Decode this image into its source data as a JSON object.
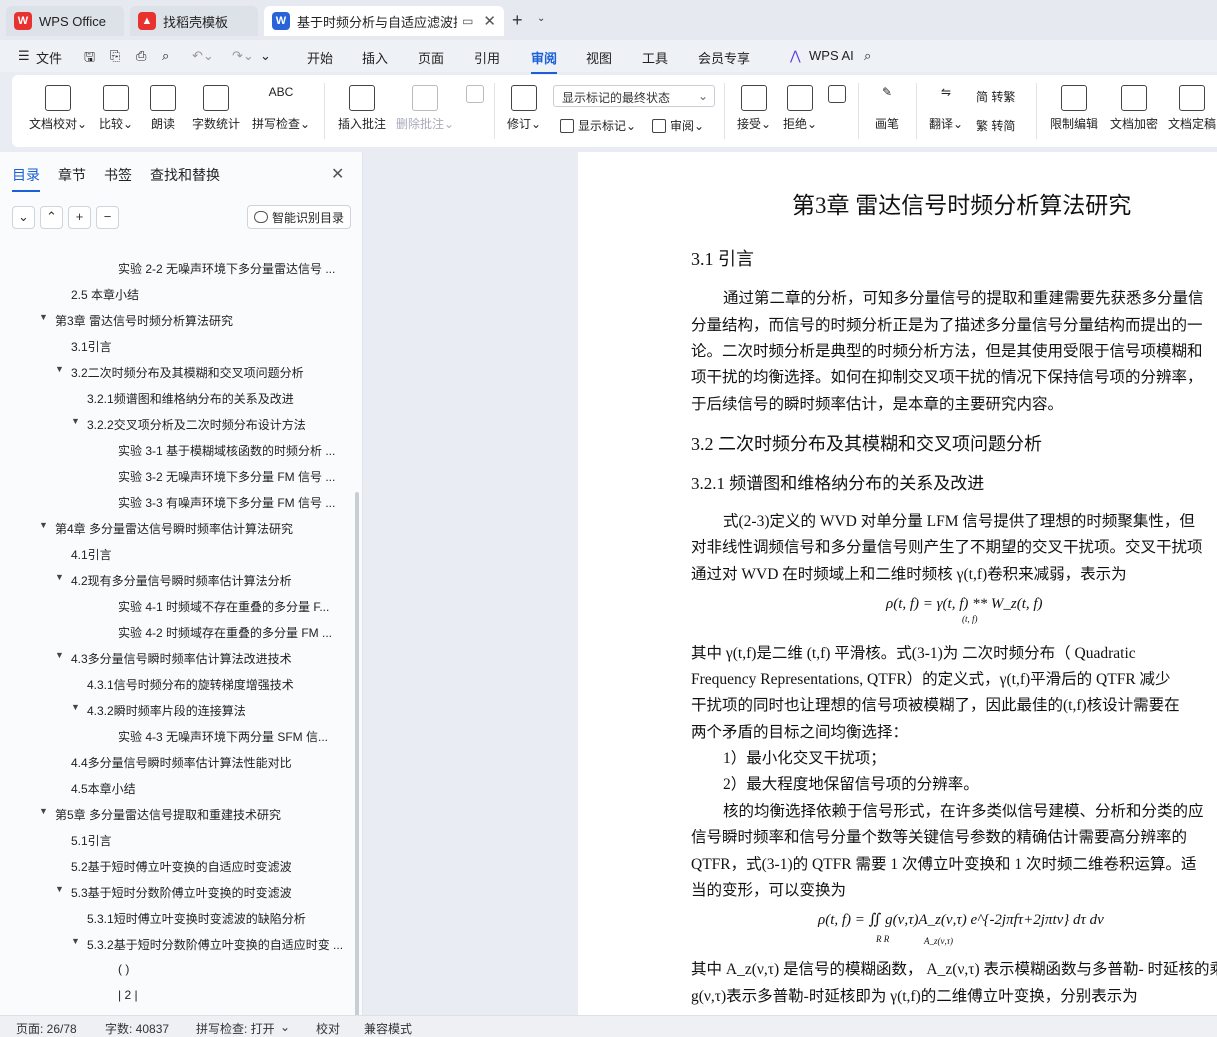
{
  "tabs": [
    {
      "label": "WPS Office",
      "icon": "wps-logo"
    },
    {
      "label": "找稻壳模板",
      "icon": "docer-logo"
    },
    {
      "label": "基于时频分析与自适应滤波技",
      "icon": "writer-logo",
      "active": true
    }
  ],
  "menu": {
    "file": "文件",
    "items": [
      "开始",
      "插入",
      "页面",
      "引用",
      "审阅",
      "视图",
      "工具",
      "会员专享"
    ],
    "active": "审阅",
    "ai": "WPS AI"
  },
  "ribbon": {
    "proof": "文档校对",
    "compare": "比较",
    "read": "朗读",
    "wordcount": "字数统计",
    "spell": "拼写检查",
    "insert_comment": "插入批注",
    "delete_comment": "删除批注",
    "revise": "修订",
    "markup_select": "显示标记的最终状态",
    "show_markup": "显示标记",
    "review": "审阅",
    "accept": "接受",
    "reject": "拒绝",
    "pen": "画笔",
    "translate": "翻译",
    "to_trad": "简 转繁",
    "to_simp": "繁 转简",
    "restrict": "限制编辑",
    "encrypt": "文档加密",
    "finalize": "文档定稿"
  },
  "sidebar": {
    "tabs": [
      "目录",
      "章节",
      "书签",
      "查找和替换"
    ],
    "active_tab": "目录",
    "smart_button": "智能识别目录",
    "toc": [
      {
        "text": "实验 2-2 无噪声环境下多分量雷达信号 ...",
        "level": 4,
        "arrow": ""
      },
      {
        "text": "2.5 本章小结",
        "level": 2,
        "arrow": ""
      },
      {
        "text": "第3章 雷达信号时频分析算法研究",
        "level": 1,
        "arrow": "▼"
      },
      {
        "text": "3.1引言",
        "level": 2,
        "arrow": ""
      },
      {
        "text": "3.2二次时频分布及其模糊和交叉项问题分析",
        "level": 2,
        "arrow": "▼"
      },
      {
        "text": "3.2.1频谱图和维格纳分布的关系及改进",
        "level": 3,
        "arrow": ""
      },
      {
        "text": "3.2.2交叉项分析及二次时频分布设计方法",
        "level": 3,
        "arrow": "▼"
      },
      {
        "text": "实验 3-1 基于模糊域核函数的时频分析 ...",
        "level": 4,
        "arrow": ""
      },
      {
        "text": "实验 3-2 无噪声环境下多分量 FM 信号 ...",
        "level": 4,
        "arrow": ""
      },
      {
        "text": "实验 3-3 有噪声环境下多分量 FM 信号 ...",
        "level": 4,
        "arrow": ""
      },
      {
        "text": "第4章 多分量雷达信号瞬时频率估计算法研究",
        "level": 1,
        "arrow": "▼"
      },
      {
        "text": "4.1引言",
        "level": 2,
        "arrow": ""
      },
      {
        "text": "4.2现有多分量信号瞬时频率估计算法分析",
        "level": 2,
        "arrow": "▼"
      },
      {
        "text": "实验 4-1 时频域不存在重叠的多分量 F...",
        "level": 4,
        "arrow": ""
      },
      {
        "text": "实验 4-2 时频域存在重叠的多分量 FM ...",
        "level": 4,
        "arrow": ""
      },
      {
        "text": "4.3多分量信号瞬时频率估计算法改进技术",
        "level": 2,
        "arrow": "▼"
      },
      {
        "text": "4.3.1信号时频分布的旋转梯度增强技术",
        "level": 3,
        "arrow": ""
      },
      {
        "text": "4.3.2瞬时频率片段的连接算法",
        "level": 3,
        "arrow": "▼"
      },
      {
        "text": "实验 4-3 无噪声环境下两分量 SFM 信...",
        "level": 4,
        "arrow": ""
      },
      {
        "text": "4.4多分量信号瞬时频率估计算法性能对比",
        "level": 2,
        "arrow": ""
      },
      {
        "text": "4.5本章小结",
        "level": 2,
        "arrow": ""
      },
      {
        "text": "第5章 多分量雷达信号提取和重建技术研究",
        "level": 1,
        "arrow": "▼"
      },
      {
        "text": "5.1引言",
        "level": 2,
        "arrow": ""
      },
      {
        "text": "5.2基于短时傅立叶变换的自适应时变滤波",
        "level": 2,
        "arrow": ""
      },
      {
        "text": "5.3基于短时分数阶傅立叶变换的时变滤波",
        "level": 2,
        "arrow": "▼"
      },
      {
        "text": "5.3.1短时傅立叶变换时变滤波的缺陷分析",
        "level": 3,
        "arrow": ""
      },
      {
        "text": "5.3.2基于短时分数阶傅立叶变换的自适应时变 ...",
        "level": 3,
        "arrow": "▼"
      },
      {
        "text": "( )",
        "level": 4,
        "arrow": ""
      },
      {
        "text": "| 2 |",
        "level": 4,
        "arrow": ""
      }
    ]
  },
  "document": {
    "chapter_title": "第3章  雷达信号时频分析算法研究",
    "s31": "3.1  引言",
    "p1": [
      "通过第二章的分析，可知多分量信号的提取和重建需要先获悉多分量信",
      "分量结构，而信号的时频分析正是为了描述多分量信号分量结构而提出的一",
      "论。二次时频分析是典型的时频分析方法，但是其使用受限于信号项模糊和",
      "项干扰的均衡选择。如何在抑制交叉项干扰的情况下保持信号项的分辨率，",
      "于后续信号的瞬时频率估计，是本章的主要研究内容。"
    ],
    "s32": "3.2  二次时频分布及其模糊和交叉项问题分析",
    "s321": "3.2.1  频谱图和维格纳分布的关系及改进",
    "p2": [
      "式(2-3)定义的  WVD 对单分量  LFM 信号提供了理想的时频聚集性，但",
      "对非线性调频信号和多分量信号则产生了不期望的交叉干扰项。交叉干扰项",
      "通过对  WVD 在时频域上和二维时频核  γ(t,f)卷积来减弱，表示为"
    ],
    "formula1": "ρ(t, f) = γ(t, f) ** W_z(t, f)",
    "formula1_sub": "(t, f)",
    "p3": [
      "其中   γ(t,f)是二维  (t,f) 平滑核。式(3-1)为  二次时频分布（ Quadratic",
      "Frequency  Representations, QTFR）的定义式，γ(t,f)平滑后的  QTFR 减少",
      "干扰项的同时也让理想的信号项被模糊了，因此最佳的(t,f)核设计需要在",
      "两个矛盾的目标之间均衡选择："
    ],
    "list": [
      "1）最小化交叉干扰项；",
      "2）最大程度地保留信号项的分辨率。"
    ],
    "p4": [
      "核的均衡选择依赖于信号形式，在许多类似信号建模、分析和分类的应",
      "信号瞬时频率和信号分量个数等关键信号参数的精确估计需要高分辨率的",
      "QTFR，式(3-1)的  QTFR 需要  1 次傅立叶变换和  1 次时频二维卷积运算。适",
      "当的变形，可以变换为"
    ],
    "formula2": "ρ(t, f) = ∬ g(ν,τ)A_z(ν,τ) e^{-2jπfτ+2jπtν} dτ dν",
    "formula2_sub": "R R",
    "formula2_under": "A_z(ν,τ)",
    "p5": [
      "其中  A_z(ν,τ) 是信号的模糊函数，  A_z(ν,τ) 表示模糊函数与多普勒- 时延核的乘",
      "g(ν,τ)表示多普勒-时延核即为  γ(t,f)的二维傅立叶变换，分别表示为"
    ]
  },
  "status": {
    "page": "页面: 26/78",
    "words": "字数: 40837",
    "spell": "拼写检查: 打开",
    "proof": "校对",
    "compat": "兼容模式"
  }
}
